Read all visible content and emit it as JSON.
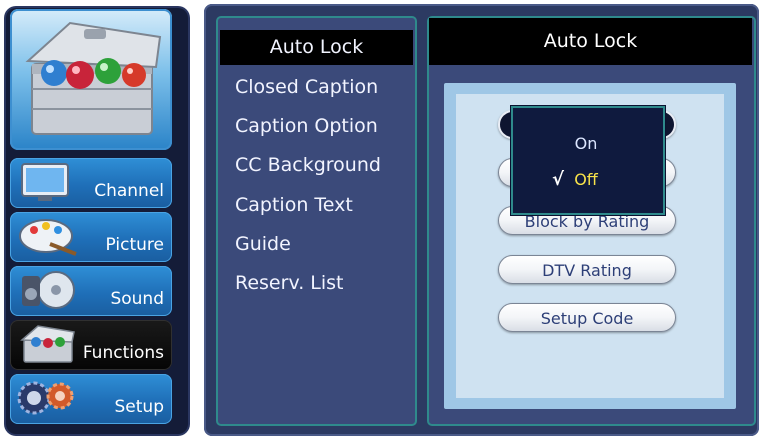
{
  "sidebar": {
    "hero_icon": "treasure-chest-icon",
    "categories": [
      {
        "label": "Channel",
        "icon": "tv-icon",
        "active": false
      },
      {
        "label": "Picture",
        "icon": "paint-palette-icon",
        "active": false
      },
      {
        "label": "Sound",
        "icon": "speaker-cd-icon",
        "active": false
      },
      {
        "label": "Functions",
        "icon": "chest-icon",
        "active": true
      },
      {
        "label": "Setup",
        "icon": "gears-icon",
        "active": false
      }
    ]
  },
  "menu": {
    "items": [
      {
        "label": "Auto Lock",
        "selected": true
      },
      {
        "label": "Closed Caption"
      },
      {
        "label": "Caption Option"
      },
      {
        "label": "CC Background"
      },
      {
        "label": "Caption Text"
      },
      {
        "label": "Guide"
      },
      {
        "label": "Reserv. List"
      }
    ]
  },
  "submenu": {
    "title": "Auto Lock",
    "buttons": [
      {
        "label": ""
      },
      {
        "label": ""
      },
      {
        "label": "Block by Rating"
      },
      {
        "label": "DTV Rating"
      },
      {
        "label": "Setup Code"
      }
    ]
  },
  "popup": {
    "options": [
      {
        "label": "On",
        "checked": false
      },
      {
        "label": "Off",
        "checked": true
      }
    ],
    "check_glyph": "√"
  },
  "colors": {
    "accent_border": "#2f8a8c",
    "selected_option": "#f7e24a",
    "category_blue": "#1f6fb8"
  }
}
